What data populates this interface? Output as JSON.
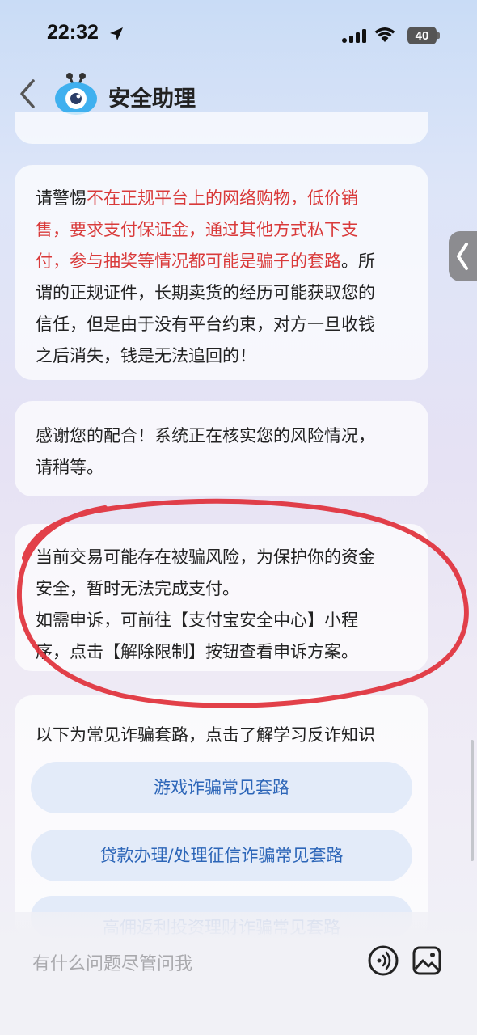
{
  "status_bar": {
    "time": "22:32",
    "battery": "40"
  },
  "header": {
    "title": "安全助理"
  },
  "messages": {
    "warning": {
      "prefix": "请警惕",
      "highlight_line1": "不在正规平台上的网络购物，低价销",
      "highlight_line2": "售，要求支付保证金，通过其他方式私下支",
      "highlight_line3": "付，参与抽奖等情况都可能是骗子的套路",
      "suffix_line3": "。所",
      "line4": "谓的正规证件，长期卖货的经历可能获取您的",
      "line5": "信任，但是由于没有平台约束，对方一旦收钱",
      "line6": "之后消失，钱是无法追回的！"
    },
    "thanks": {
      "line1": "感谢您的配合！系统正在核实您的风险情况，",
      "line2": "请稍等。"
    },
    "risk": {
      "line1": "当前交易可能存在被骗风险，为保护你的资金",
      "line2": "安全，暂时无法完成支付。",
      "line3": "如需申诉，可前往【支付宝安全中心】小程",
      "line4": "序，点击【解除限制】按钮查看申诉方案。"
    },
    "fraud": {
      "intro": "以下为常见诈骗套路，点击了解学习反诈知识",
      "links": [
        "游戏诈骗常见套路",
        "贷款办理/处理征信诈骗常见套路",
        "高佣返利投资理财诈骗常见套路"
      ]
    }
  },
  "input": {
    "placeholder": "有什么问题尽管问我"
  },
  "colors": {
    "warning_red": "#d93a3a",
    "link_blue": "#2d66b8",
    "annotation_red": "#e0303a"
  },
  "icons": [
    "location-arrow-icon",
    "signal-icon",
    "wifi-icon",
    "back-icon",
    "assistant-logo-icon",
    "voice-icon",
    "image-icon",
    "side-handle-chevron-icon"
  ]
}
